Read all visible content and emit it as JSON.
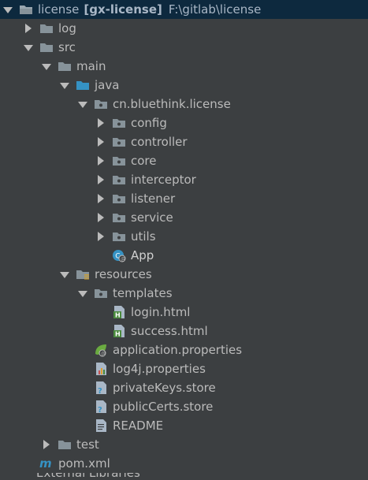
{
  "window": {
    "bg": "#3c3f41"
  },
  "project": {
    "name": "license",
    "module": "[gx-license]",
    "path": "F:\\gitlab\\license"
  },
  "tree": {
    "log": "log",
    "src": "src",
    "main": "main",
    "java": "java",
    "package": "cn.bluethink.license",
    "config": "config",
    "controller": "controller",
    "core": "core",
    "interceptor": "interceptor",
    "listener": "listener",
    "service": "service",
    "utils": "utils",
    "app": "App",
    "resources": "resources",
    "templates": "templates",
    "login": "login.html",
    "success": "success.html",
    "application": "application.properties",
    "log4j": "log4j.properties",
    "privateKeys": "privateKeys.store",
    "publicCerts": "publicCerts.store",
    "readme": "README",
    "test": "test",
    "pom": "pom.xml"
  },
  "footer": {
    "label": "External Libraries"
  },
  "icons": {
    "folder": "folder-icon",
    "package": "package-icon",
    "class": "class-icon",
    "html": "html-file-icon",
    "spring": "spring-properties-icon",
    "props": "properties-icon",
    "store": "store-file-icon",
    "text": "text-file-icon",
    "maven": "maven-icon"
  }
}
